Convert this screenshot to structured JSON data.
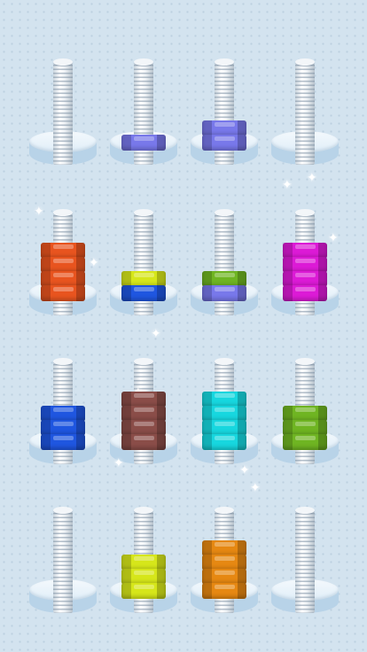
{
  "game": {
    "colors": {
      "orange": "#e8541f",
      "yellow": "#d6e61a",
      "blue": "#1f56e0",
      "periwinkle": "#7878ea",
      "green": "#6fb522",
      "magenta": "#dc1ad6",
      "teal": "#17d7df",
      "brown": "#8a4d48",
      "amber": "#e68812",
      "background": "#d3e3ef"
    },
    "bolts": [
      {
        "id": 1,
        "nuts": []
      },
      {
        "id": 2,
        "nuts": [
          "periwinkle"
        ]
      },
      {
        "id": 3,
        "nuts": [
          "periwinkle",
          "periwinkle"
        ]
      },
      {
        "id": 4,
        "nuts": []
      },
      {
        "id": 5,
        "nuts": [
          "orange",
          "orange",
          "orange",
          "orange"
        ]
      },
      {
        "id": 6,
        "nuts": [
          "blue",
          "yellow"
        ]
      },
      {
        "id": 7,
        "nuts": [
          "periwinkle",
          "green"
        ]
      },
      {
        "id": 8,
        "nuts": [
          "magenta",
          "magenta",
          "magenta",
          "magenta"
        ]
      },
      {
        "id": 9,
        "nuts": [
          "blue",
          "blue",
          "blue"
        ]
      },
      {
        "id": 10,
        "nuts": [
          "brown",
          "brown",
          "brown",
          "brown"
        ]
      },
      {
        "id": 11,
        "nuts": [
          "teal",
          "teal",
          "teal",
          "teal"
        ]
      },
      {
        "id": 12,
        "nuts": [
          "green",
          "green",
          "green"
        ]
      },
      {
        "id": 13,
        "nuts": []
      },
      {
        "id": 14,
        "nuts": [
          "yellow",
          "yellow",
          "yellow"
        ]
      },
      {
        "id": 15,
        "nuts": [
          "amber",
          "amber",
          "amber",
          "amber"
        ]
      },
      {
        "id": 16,
        "nuts": []
      }
    ],
    "sparkle_icon": "sparkle-icon"
  }
}
